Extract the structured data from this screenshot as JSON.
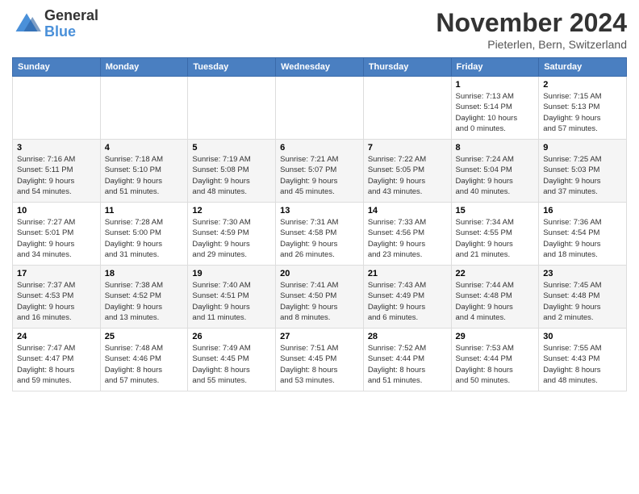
{
  "header": {
    "logo_general": "General",
    "logo_blue": "Blue",
    "month_title": "November 2024",
    "location": "Pieterlen, Bern, Switzerland"
  },
  "weekdays": [
    "Sunday",
    "Monday",
    "Tuesday",
    "Wednesday",
    "Thursday",
    "Friday",
    "Saturday"
  ],
  "weeks": [
    [
      {
        "day": "",
        "info": ""
      },
      {
        "day": "",
        "info": ""
      },
      {
        "day": "",
        "info": ""
      },
      {
        "day": "",
        "info": ""
      },
      {
        "day": "",
        "info": ""
      },
      {
        "day": "1",
        "info": "Sunrise: 7:13 AM\nSunset: 5:14 PM\nDaylight: 10 hours\nand 0 minutes."
      },
      {
        "day": "2",
        "info": "Sunrise: 7:15 AM\nSunset: 5:13 PM\nDaylight: 9 hours\nand 57 minutes."
      }
    ],
    [
      {
        "day": "3",
        "info": "Sunrise: 7:16 AM\nSunset: 5:11 PM\nDaylight: 9 hours\nand 54 minutes."
      },
      {
        "day": "4",
        "info": "Sunrise: 7:18 AM\nSunset: 5:10 PM\nDaylight: 9 hours\nand 51 minutes."
      },
      {
        "day": "5",
        "info": "Sunrise: 7:19 AM\nSunset: 5:08 PM\nDaylight: 9 hours\nand 48 minutes."
      },
      {
        "day": "6",
        "info": "Sunrise: 7:21 AM\nSunset: 5:07 PM\nDaylight: 9 hours\nand 45 minutes."
      },
      {
        "day": "7",
        "info": "Sunrise: 7:22 AM\nSunset: 5:05 PM\nDaylight: 9 hours\nand 43 minutes."
      },
      {
        "day": "8",
        "info": "Sunrise: 7:24 AM\nSunset: 5:04 PM\nDaylight: 9 hours\nand 40 minutes."
      },
      {
        "day": "9",
        "info": "Sunrise: 7:25 AM\nSunset: 5:03 PM\nDaylight: 9 hours\nand 37 minutes."
      }
    ],
    [
      {
        "day": "10",
        "info": "Sunrise: 7:27 AM\nSunset: 5:01 PM\nDaylight: 9 hours\nand 34 minutes."
      },
      {
        "day": "11",
        "info": "Sunrise: 7:28 AM\nSunset: 5:00 PM\nDaylight: 9 hours\nand 31 minutes."
      },
      {
        "day": "12",
        "info": "Sunrise: 7:30 AM\nSunset: 4:59 PM\nDaylight: 9 hours\nand 29 minutes."
      },
      {
        "day": "13",
        "info": "Sunrise: 7:31 AM\nSunset: 4:58 PM\nDaylight: 9 hours\nand 26 minutes."
      },
      {
        "day": "14",
        "info": "Sunrise: 7:33 AM\nSunset: 4:56 PM\nDaylight: 9 hours\nand 23 minutes."
      },
      {
        "day": "15",
        "info": "Sunrise: 7:34 AM\nSunset: 4:55 PM\nDaylight: 9 hours\nand 21 minutes."
      },
      {
        "day": "16",
        "info": "Sunrise: 7:36 AM\nSunset: 4:54 PM\nDaylight: 9 hours\nand 18 minutes."
      }
    ],
    [
      {
        "day": "17",
        "info": "Sunrise: 7:37 AM\nSunset: 4:53 PM\nDaylight: 9 hours\nand 16 minutes."
      },
      {
        "day": "18",
        "info": "Sunrise: 7:38 AM\nSunset: 4:52 PM\nDaylight: 9 hours\nand 13 minutes."
      },
      {
        "day": "19",
        "info": "Sunrise: 7:40 AM\nSunset: 4:51 PM\nDaylight: 9 hours\nand 11 minutes."
      },
      {
        "day": "20",
        "info": "Sunrise: 7:41 AM\nSunset: 4:50 PM\nDaylight: 9 hours\nand 8 minutes."
      },
      {
        "day": "21",
        "info": "Sunrise: 7:43 AM\nSunset: 4:49 PM\nDaylight: 9 hours\nand 6 minutes."
      },
      {
        "day": "22",
        "info": "Sunrise: 7:44 AM\nSunset: 4:48 PM\nDaylight: 9 hours\nand 4 minutes."
      },
      {
        "day": "23",
        "info": "Sunrise: 7:45 AM\nSunset: 4:48 PM\nDaylight: 9 hours\nand 2 minutes."
      }
    ],
    [
      {
        "day": "24",
        "info": "Sunrise: 7:47 AM\nSunset: 4:47 PM\nDaylight: 8 hours\nand 59 minutes."
      },
      {
        "day": "25",
        "info": "Sunrise: 7:48 AM\nSunset: 4:46 PM\nDaylight: 8 hours\nand 57 minutes."
      },
      {
        "day": "26",
        "info": "Sunrise: 7:49 AM\nSunset: 4:45 PM\nDaylight: 8 hours\nand 55 minutes."
      },
      {
        "day": "27",
        "info": "Sunrise: 7:51 AM\nSunset: 4:45 PM\nDaylight: 8 hours\nand 53 minutes."
      },
      {
        "day": "28",
        "info": "Sunrise: 7:52 AM\nSunset: 4:44 PM\nDaylight: 8 hours\nand 51 minutes."
      },
      {
        "day": "29",
        "info": "Sunrise: 7:53 AM\nSunset: 4:44 PM\nDaylight: 8 hours\nand 50 minutes."
      },
      {
        "day": "30",
        "info": "Sunrise: 7:55 AM\nSunset: 4:43 PM\nDaylight: 8 hours\nand 48 minutes."
      }
    ]
  ]
}
